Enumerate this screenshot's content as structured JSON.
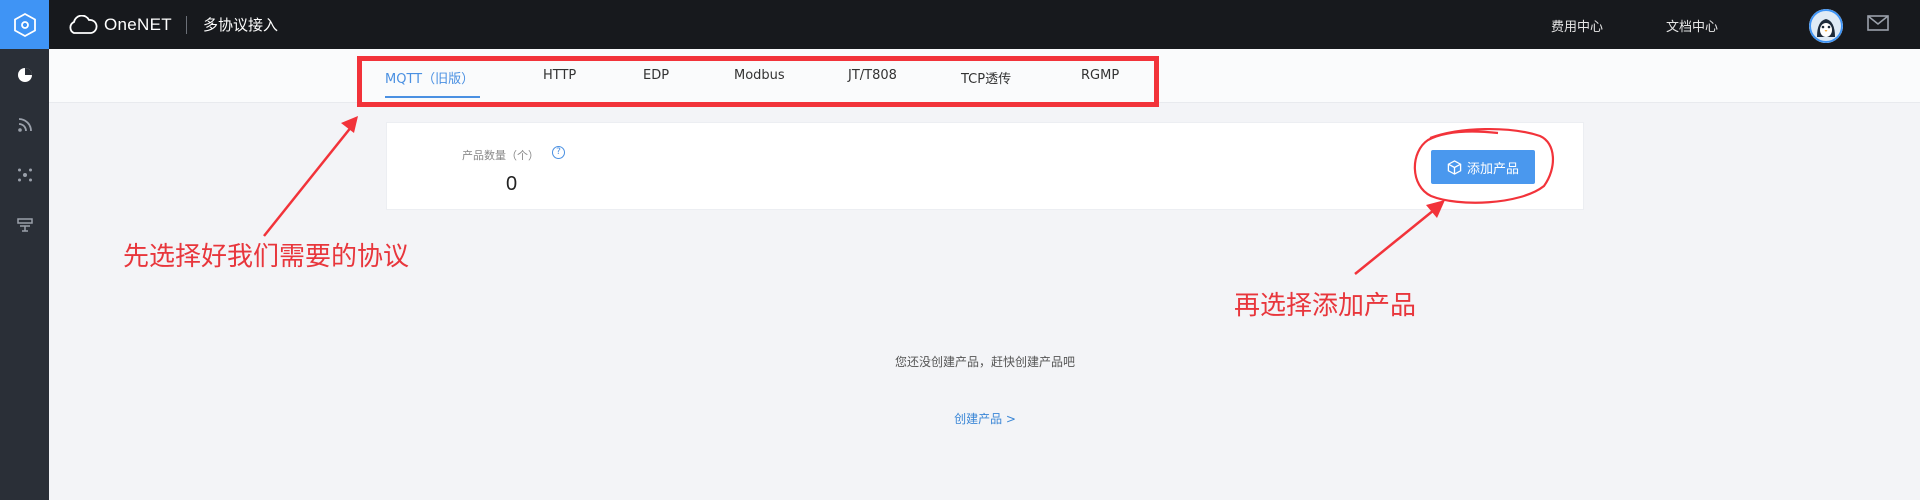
{
  "app": {
    "brand": "OneNET",
    "section_title": "多协议接入"
  },
  "topbar": {
    "links": [
      "费用中心",
      "文档中心"
    ]
  },
  "sidebar": {
    "icons": [
      "onenet-logo-icon",
      "dashboard-pie-icon",
      "signal-icon",
      "nodes-icon",
      "device-icon"
    ]
  },
  "tabs": [
    {
      "label": "MQTT（旧版）",
      "active": true
    },
    {
      "label": "HTTP",
      "active": false
    },
    {
      "label": "EDP",
      "active": false
    },
    {
      "label": "Modbus",
      "active": false
    },
    {
      "label": "JT/T808",
      "active": false
    },
    {
      "label": "TCP透传",
      "active": false
    },
    {
      "label": "RGMP",
      "active": false
    }
  ],
  "stats": {
    "label": "产品数量（个）",
    "help": "?",
    "value": "0"
  },
  "actions": {
    "add_product": "添加产品"
  },
  "empty_state": {
    "message": "您还没创建产品，赶快创建产品吧",
    "link": "创建产品 >"
  },
  "annotations": {
    "choose_protocol": "先选择好我们需要的协议",
    "add_product": "再选择添加产品"
  },
  "colors": {
    "accent": "#4a90e2",
    "button": "#4a98ee",
    "topbar": "#17191d",
    "sidebar": "#2a2f37",
    "annotation": "#f2333a"
  }
}
